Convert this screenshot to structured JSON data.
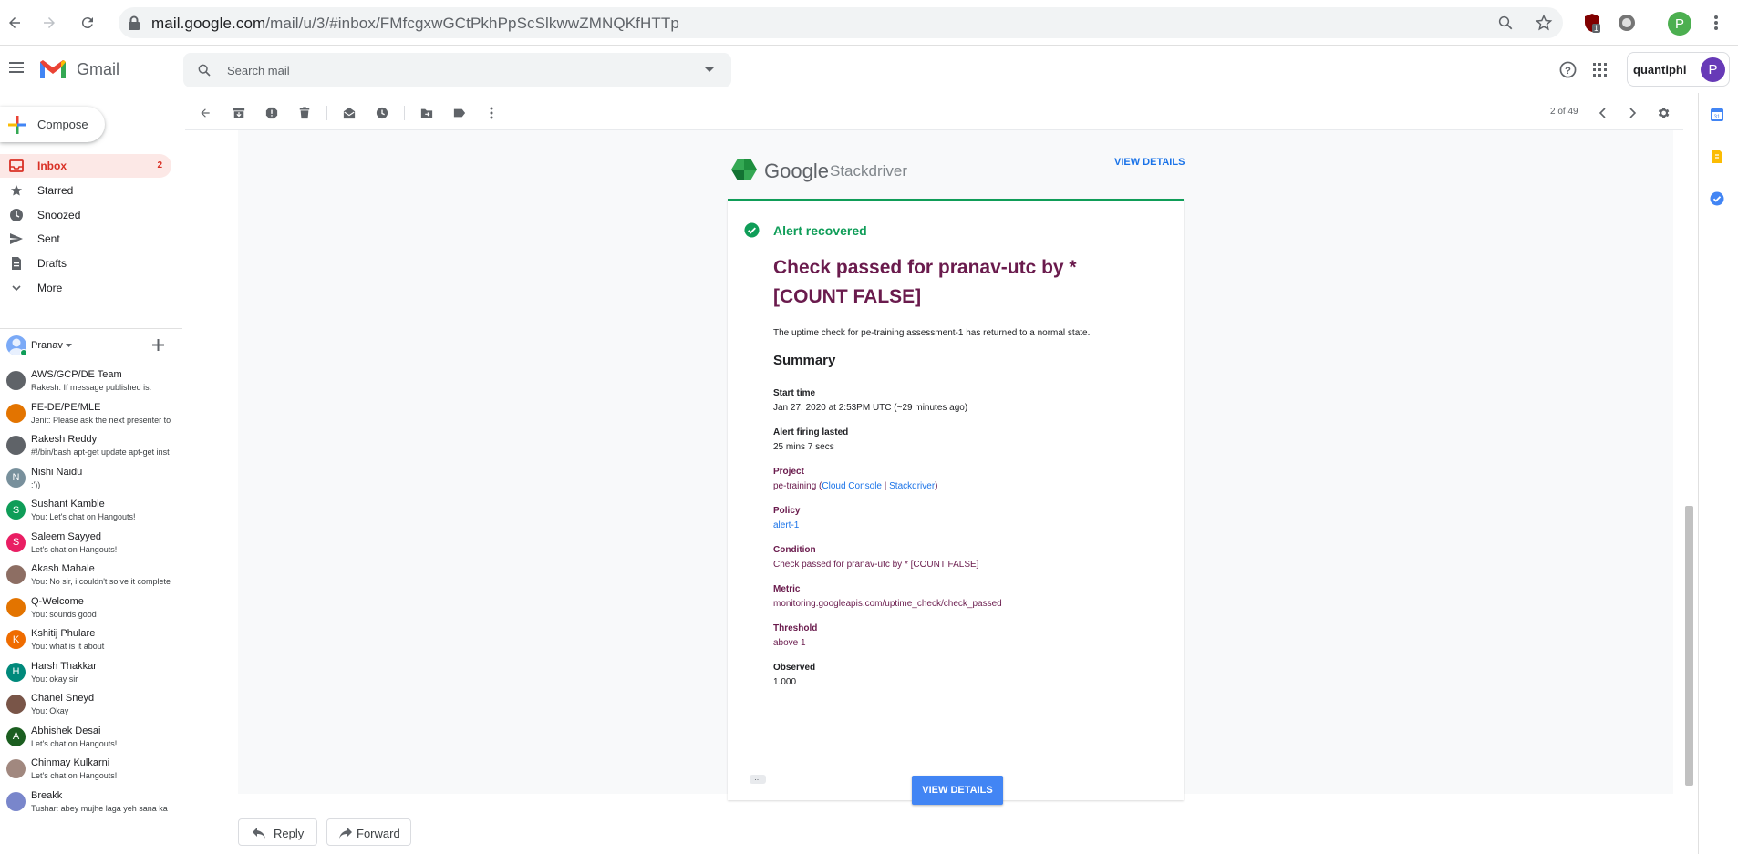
{
  "browser": {
    "url_domain": "mail.google.com",
    "url_path": "/mail/u/3/#inbox/FMfcgxwGCtPkhPpScSlkwwZMNQKfHTTp",
    "ext_badge": "1",
    "profile_initial": "P"
  },
  "header": {
    "app_name": "Gmail",
    "search_placeholder": "Search mail",
    "org_logo": "quantiphi",
    "account_initial": "P"
  },
  "sidebar": {
    "compose_label": "Compose",
    "items": [
      {
        "label": "Inbox",
        "count": "2",
        "icon": "inbox-icon"
      },
      {
        "label": "Starred",
        "count": "",
        "icon": "star-icon"
      },
      {
        "label": "Snoozed",
        "count": "",
        "icon": "clock-icon"
      },
      {
        "label": "Sent",
        "count": "",
        "icon": "send-icon"
      },
      {
        "label": "Drafts",
        "count": "",
        "icon": "draft-icon"
      },
      {
        "label": "More",
        "count": "",
        "icon": "chevron-down-icon"
      }
    ],
    "hangouts_user": "Pranav",
    "chats": [
      {
        "name": "AWS/GCP/DE Team",
        "msg": "Rakesh: If message published is:",
        "initial": "",
        "color": "#5f6368"
      },
      {
        "name": "FE-DE/PE/MLE",
        "msg": "Jenit: Please ask the next presenter to",
        "initial": "",
        "color": "#e37400"
      },
      {
        "name": "Rakesh Reddy",
        "msg": "#!/bin/bash apt-get update apt-get inst",
        "initial": "",
        "color": "#5f6368"
      },
      {
        "name": "Nishi Naidu",
        "msg": ":'))",
        "initial": "N",
        "color": "#78909c"
      },
      {
        "name": "Sushant Kamble",
        "msg": "You: Let's chat on Hangouts!",
        "initial": "S",
        "color": "#0f9d58"
      },
      {
        "name": "Saleem Sayyed",
        "msg": "Let's chat on Hangouts!",
        "initial": "S",
        "color": "#e91e63"
      },
      {
        "name": "Akash Mahale",
        "msg": "You: No sir, i couldn't solve it complete",
        "initial": "",
        "color": "#8d6e63"
      },
      {
        "name": "Q-Welcome",
        "msg": "You: sounds good",
        "initial": "",
        "color": "#e37400"
      },
      {
        "name": "Kshitij Phulare",
        "msg": "You: what is it about",
        "initial": "K",
        "color": "#ef6c00"
      },
      {
        "name": "Harsh Thakkar",
        "msg": "You: okay sir",
        "initial": "H",
        "color": "#00897b"
      },
      {
        "name": "Chanel Sneyd",
        "msg": "You: Okay",
        "initial": "",
        "color": "#795548"
      },
      {
        "name": "Abhishek Desai",
        "msg": "Let's chat on Hangouts!",
        "initial": "A",
        "color": "#1b5e20"
      },
      {
        "name": "Chinmay Kulkarni",
        "msg": "Let's chat on Hangouts!",
        "initial": "",
        "color": "#a1887f"
      },
      {
        "name": "Breakk",
        "msg": "Tushar: abey mujhe laga yeh sana ka",
        "initial": "",
        "color": "#7986cb"
      }
    ]
  },
  "toolbar": {
    "pager": "2 of 49"
  },
  "email": {
    "brand_google": "Google",
    "brand_product": "Stackdriver",
    "view_details_top": "VIEW DETAILS",
    "status": "Alert recovered",
    "title": "Check passed for pranav-utc by * [COUNT FALSE]",
    "description": "The uptime check for pe-training assessment-1 has returned to a normal state.",
    "summary_heading": "Summary",
    "start_time_label": "Start time",
    "start_time_value": "Jan 27, 2020 at 2:53PM UTC (~29 minutes ago)",
    "firing_label": "Alert firing lasted",
    "firing_value": "25 mins 7 secs",
    "project_label": "Project",
    "project_name": "pe-training",
    "project_paren_open": " (",
    "project_link1": "Cloud Console",
    "project_sep": " | ",
    "project_link2": "Stackdriver",
    "project_paren_close": ")",
    "policy_label": "Policy",
    "policy_value": "alert-1",
    "condition_label": "Condition",
    "condition_value": "Check passed for pranav-utc by * [COUNT FALSE]",
    "metric_label": "Metric",
    "metric_value": "monitoring.googleapis.com/uptime_check/check_passed",
    "threshold_label": "Threshold",
    "threshold_value": "above 1",
    "observed_label": "Observed",
    "observed_value": "1.000",
    "view_details_button": "VIEW DETAILS"
  },
  "actions": {
    "reply": "Reply",
    "forward": "Forward"
  }
}
